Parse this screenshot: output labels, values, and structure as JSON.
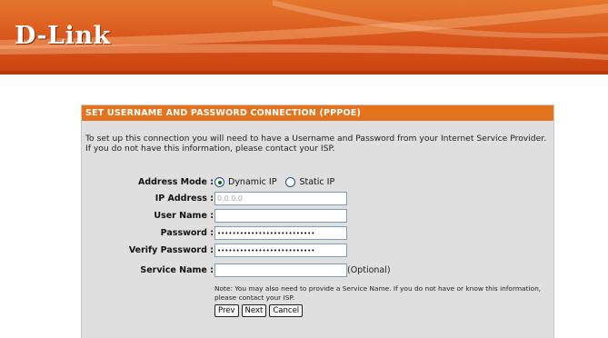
{
  "header": {
    "logo_text": "D-Link",
    "accent_color": "#e3731c"
  },
  "panel": {
    "title": "SET USERNAME AND PASSWORD CONNECTION (PPPOE)",
    "intro": "To set up this connection you will need to have a Username and Password from your Internet Service Provider. If you do not have this information, please contact your ISP."
  },
  "form": {
    "address_mode": {
      "label": "Address Mode :",
      "options": [
        "Dynamic IP",
        "Static IP"
      ],
      "selected": "Dynamic IP"
    },
    "ip_address": {
      "label": "IP Address :",
      "value": "0.0.0.0"
    },
    "user_name": {
      "label": "User Name :",
      "value": ""
    },
    "password": {
      "label": "Password :",
      "value": "••••••••••••••••••••••••••"
    },
    "verify_password": {
      "label": "Verify Password :",
      "value": "••••••••••••••••••••••••••"
    },
    "service_name": {
      "label": "Service Name :",
      "value": "",
      "optional_text": "(Optional)"
    },
    "note": "Note: You may also need to provide a Service Name. If you do not have or know this information, please contact your ISP."
  },
  "buttons": {
    "prev": "Prev",
    "next": "Next",
    "cancel": "Cancel"
  }
}
